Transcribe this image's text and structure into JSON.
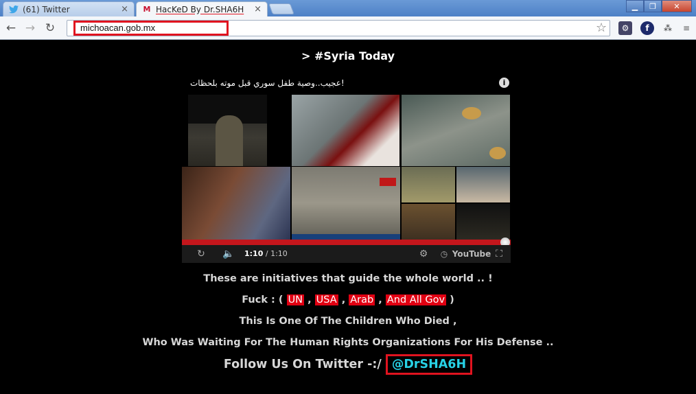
{
  "browser": {
    "tabs": [
      {
        "title": "(61) Twitter",
        "icon": "twitter-bird-icon",
        "active": false
      },
      {
        "title": "HacKeD By Dr.SHA6H",
        "icon": "mcafee-m-icon",
        "active": true
      }
    ],
    "url": "michoacan.gob.mx",
    "accent_red": "#e0131f"
  },
  "page": {
    "heading": "> #Syria Today",
    "video": {
      "title": "!عجيب..وصية طفل سوري قبل موته بلحظات",
      "time_current": "1:10",
      "time_total": "/ 1:10",
      "progress_fraction": 1.0,
      "youtube_label": "YouTube"
    },
    "lines": {
      "line1": "These are initiatives that guide the whole world .. !",
      "fuck_prefix": "Fuck : (",
      "targets": [
        "UN",
        "USA",
        "Arab",
        "And All Gov"
      ],
      "fuck_suffix": ")",
      "line3": "This Is One Of The Children Who Died ,",
      "line4": "Who Was Waiting For The Human Rights Organizations For His Defense ..",
      "follow_prefix": "Follow Us On Twitter -:/",
      "twitter_handle": "@DrSHA6H"
    },
    "colors": {
      "background": "#000000",
      "text": "#d7d7d7",
      "chip_red": "#e10012",
      "handle_cyan": "#27d2e6"
    }
  }
}
